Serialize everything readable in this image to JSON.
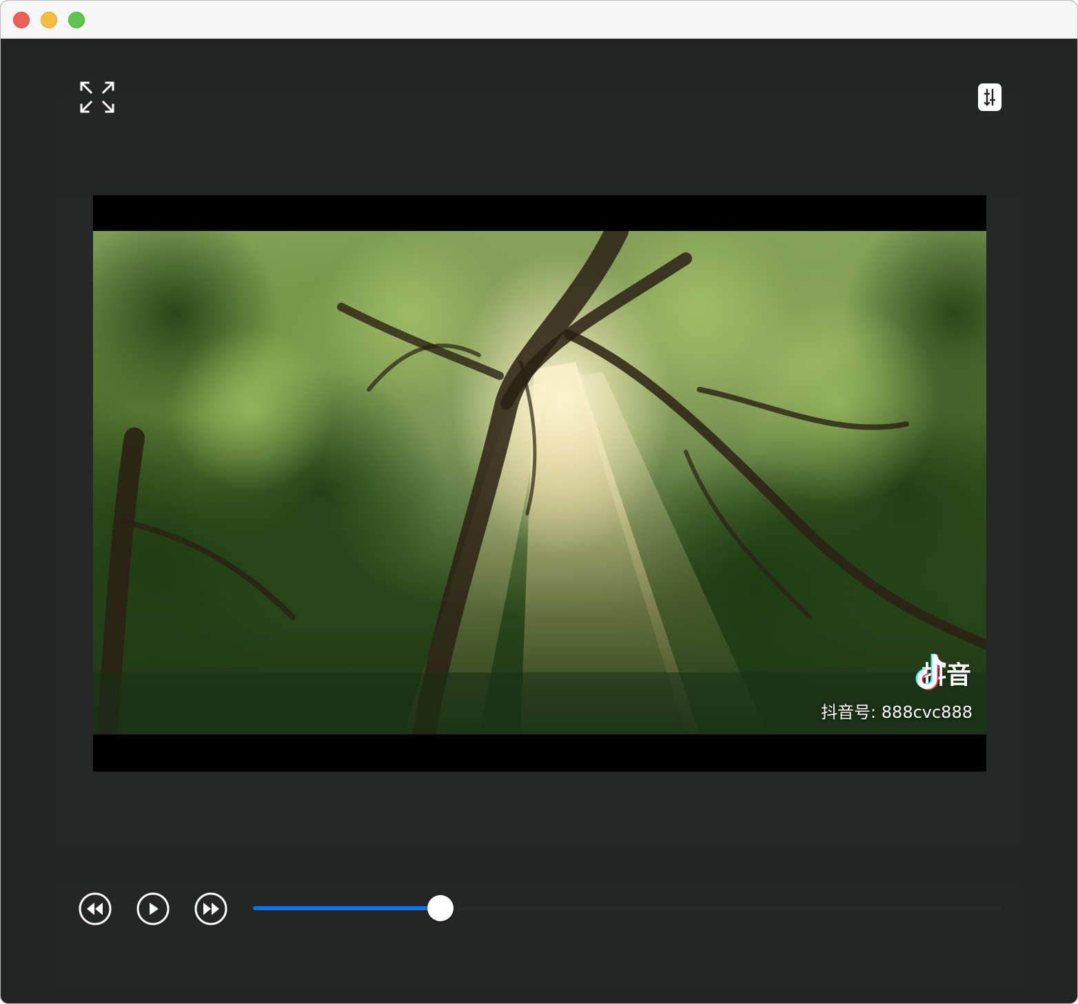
{
  "window": {
    "controls": [
      "close",
      "minimize",
      "zoom"
    ]
  },
  "toolbar": {
    "fullscreen_icon": "expand-arrows-icon",
    "adjust_icon": "sliders-icon"
  },
  "video": {
    "watermark_brand": "抖音",
    "watermark_id": "抖音号: 888cvc888",
    "scene": "sunlit forest canopy"
  },
  "playback": {
    "rewind_icon": "rewind-icon",
    "play_icon": "play-icon",
    "forward_icon": "fast-forward-icon",
    "progress": 0.25
  },
  "colors": {
    "accent": "#0a74ea",
    "background": "#232424",
    "close": "#ee5f57",
    "minimize": "#f5bd3d",
    "zoom": "#5ec64e"
  }
}
